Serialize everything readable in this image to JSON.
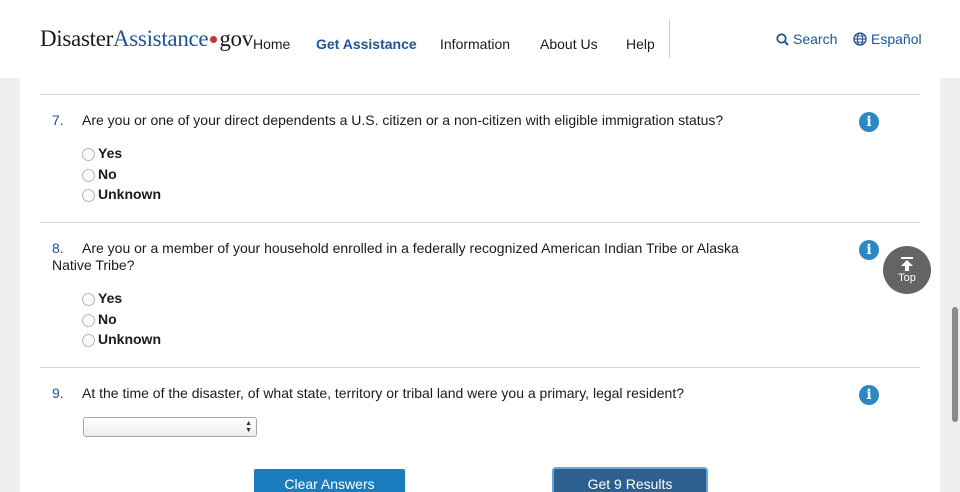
{
  "header": {
    "logo": {
      "part1": "Disaster",
      "part2": "Assistance",
      "part3": "gov"
    },
    "nav": [
      {
        "label": "Home",
        "active": false
      },
      {
        "label": "Get Assistance",
        "active": true
      },
      {
        "label": "Information",
        "active": false
      },
      {
        "label": "About Us",
        "active": false
      },
      {
        "label": "Help",
        "active": false
      }
    ],
    "search_label": "Search",
    "language_label": "Español"
  },
  "questions": [
    {
      "number": "7.",
      "text": "Are you or one of your direct dependents a U.S. citizen or a non-citizen with eligible immigration status?",
      "options": [
        "Yes",
        "No",
        "Unknown"
      ],
      "info_icon": "i"
    },
    {
      "number": "8.",
      "text": "Are you or a member of your household enrolled in a federally recognized American Indian Tribe or Alaska Native Tribe?",
      "options": [
        "Yes",
        "No",
        "Unknown"
      ],
      "info_icon": "i"
    },
    {
      "number": "9.",
      "text": "At the time of the disaster, of what state, territory or tribal land were you a primary, legal resident?",
      "select_value": "",
      "info_icon": "i"
    }
  ],
  "buttons": {
    "clear": "Clear Answers",
    "results": "Get 9 Results"
  },
  "back_to_top": "Top",
  "colors": {
    "brand_blue": "#205493",
    "info_blue": "#2c87c5",
    "button_blue": "#1a7bbd",
    "button_dark": "#2d5f8f",
    "logo_dot": "#c9362d"
  }
}
